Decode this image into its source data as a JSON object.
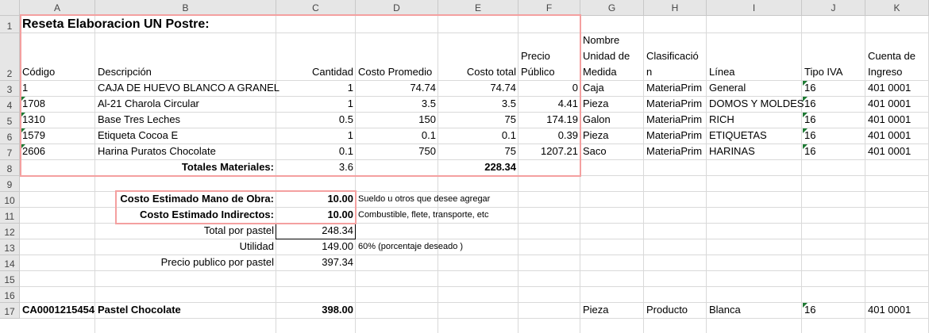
{
  "columns": [
    "A",
    "B",
    "C",
    "D",
    "E",
    "F",
    "G",
    "H",
    "I",
    "J",
    "K"
  ],
  "row_numbers": [
    "1",
    "2",
    "3",
    "4",
    "5",
    "6",
    "7",
    "8",
    "9",
    "10",
    "11",
    "12",
    "13",
    "14",
    "15",
    "16",
    "17"
  ],
  "title": "Reseta Elaboracion UN Postre:",
  "headers": {
    "codigo": "Código",
    "descripcion": "Descripción",
    "cantidad": "Cantidad",
    "costo_promedio": "Costo Promedio",
    "costo_total": "Costo total",
    "precio_l1": "Precio",
    "precio_l2": "Público",
    "unidad_l1": "Nombre",
    "unidad_l2": "Unidad de",
    "unidad_l3": "Medida",
    "clasif_l1": "Clasificació",
    "clasif_l2": "n",
    "linea": "Línea",
    "tipo_iva": "Tipo IVA",
    "cuenta_l1": "Cuenta de",
    "cuenta_l2": "Ingreso"
  },
  "rows": [
    {
      "codigo": "1",
      "descripcion": "CAJA DE HUEVO BLANCO A GRANEL",
      "cantidad": "1",
      "costo_promedio": "74.74",
      "costo_total": "74.74",
      "precio": "0",
      "unidad": "Caja",
      "clasificacion": "MateriaPrim",
      "linea": "General",
      "tipo_iva": "16",
      "cuenta": "401 0001"
    },
    {
      "codigo": "1708",
      "descripcion": "Al-21 Charola Circular",
      "cantidad": "1",
      "costo_promedio": "3.5",
      "costo_total": "3.5",
      "precio": "4.41",
      "unidad": "Pieza",
      "clasificacion": "MateriaPrim",
      "linea": "DOMOS Y MOLDES",
      "tipo_iva": "16",
      "cuenta": "401 0001"
    },
    {
      "codigo": "1310",
      "descripcion": "Base Tres Leches",
      "cantidad": "0.5",
      "costo_promedio": "150",
      "costo_total": "75",
      "precio": "174.19",
      "unidad": "Galon",
      "clasificacion": "MateriaPrim",
      "linea": "RICH",
      "tipo_iva": "16",
      "cuenta": "401 0001"
    },
    {
      "codigo": "1579",
      "descripcion": "Etiqueta Cocoa E",
      "cantidad": "1",
      "costo_promedio": "0.1",
      "costo_total": "0.1",
      "precio": "0.39",
      "unidad": "Pieza",
      "clasificacion": "MateriaPrim",
      "linea": "ETIQUETAS",
      "tipo_iva": "16",
      "cuenta": "401 0001"
    },
    {
      "codigo": "2606",
      "descripcion": "Harina Puratos Chocolate",
      "cantidad": "0.1",
      "costo_promedio": "750",
      "costo_total": "75",
      "precio": "1207.21",
      "unidad": "Saco",
      "clasificacion": "MateriaPrim",
      "linea": "HARINAS",
      "tipo_iva": "16",
      "cuenta": "401 0001"
    }
  ],
  "totales": {
    "label": "Totales Materiales:",
    "cantidad": "3.6",
    "costo_total": "228.34"
  },
  "mano_obra": {
    "label": "Costo Estimado Mano de Obra:",
    "value": "10.00",
    "note": "Sueldo u otros que desee agregar"
  },
  "indirectos": {
    "label": "Costo Estimado Indirectos:",
    "value": "10.00",
    "note": "Combustible, flete, transporte, etc"
  },
  "total_pastel": {
    "label": "Total por pastel",
    "value": "248.34"
  },
  "utilidad": {
    "label": "Utilidad",
    "value": "149.00",
    "note": "60% (porcentaje deseado )"
  },
  "precio_publico": {
    "label": "Precio  publico por pastel",
    "value": "397.34"
  },
  "producto": {
    "codigo": "CA0001215454",
    "descripcion": "Pastel Chocolate",
    "precio": "398.00",
    "unidad": "Pieza",
    "clasificacion": "Producto",
    "linea": "Blanca",
    "tipo_iva": "16",
    "cuenta": "401 0001"
  },
  "colors": {
    "highlight": "#f4a0a0",
    "triangle": "#1e7b34",
    "header_bg": "#e6e6e6",
    "gridline": "#d9d9d9"
  }
}
